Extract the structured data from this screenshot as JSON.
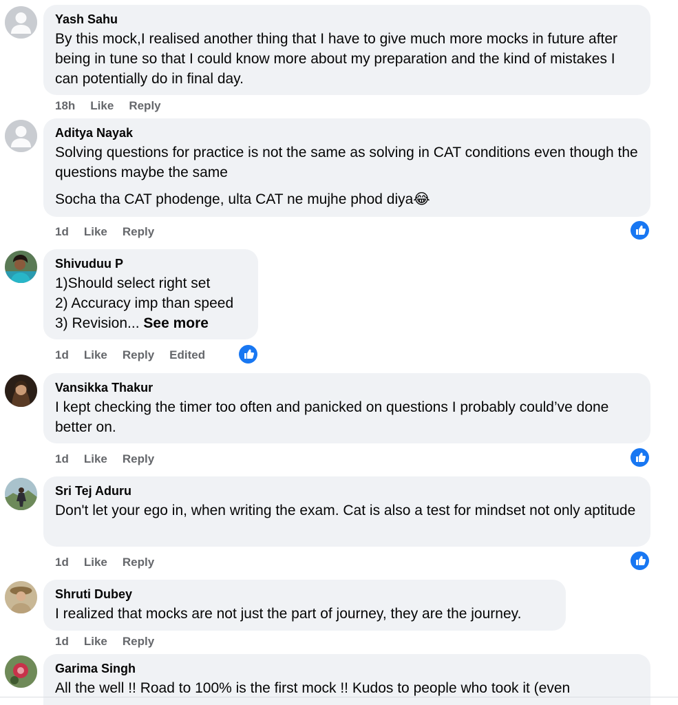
{
  "comments": [
    {
      "author": "Yash Sahu",
      "paragraphs": [
        "By this mock,I realised another thing that I have to give much more mocks in future after being in tune so that I could know more about my preparation and the kind of mistakes I can potentially do in final day."
      ],
      "time": "18h",
      "like": "Like",
      "reply": "Reply"
    },
    {
      "author": "Aditya Nayak",
      "paragraphs": [
        "Solving questions for practice is not the same as solving in CAT conditions even though the questions maybe the same",
        "Socha tha CAT phodenge, ulta CAT ne mujhe phod diya"
      ],
      "emoji": "😂",
      "time": "1d",
      "like": "Like",
      "reply": "Reply"
    },
    {
      "author": "Shivuduu P",
      "lines": [
        "1)Should select right set",
        "2) Accuracy imp than speed",
        "3) Revision..."
      ],
      "see_more": "See more",
      "time": "1d",
      "like": "Like",
      "reply": "Reply",
      "edited": "Edited"
    },
    {
      "author": "Vansikka Thakur",
      "paragraphs": [
        "I kept checking the timer too often and panicked on questions I probably could’ve done better on."
      ],
      "time": "1d",
      "like": "Like",
      "reply": "Reply"
    },
    {
      "author": "Sri Tej Aduru",
      "paragraphs": [
        "Don't let your ego in, when writing the exam. Cat is also a test for mindset not only aptitude"
      ],
      "time": "1d",
      "like": "Like",
      "reply": "Reply"
    },
    {
      "author": "Shruti Dubey",
      "paragraphs": [
        "I realized that mocks are not just the part of journey, they are the journey."
      ],
      "time": "1d",
      "like": "Like",
      "reply": "Reply"
    },
    {
      "author": "Garima Singh",
      "paragraphs": [
        "All the well !! Road to 100% is the first mock !! Kudos to people who took it (even"
      ]
    }
  ],
  "icons": {
    "default_avatar": "default-avatar-icon",
    "like_reaction": "like-reaction-icon"
  },
  "colors": {
    "bubble": "#f0f2f5",
    "meta_text": "#65676b",
    "like_blue": "#1877f2"
  }
}
